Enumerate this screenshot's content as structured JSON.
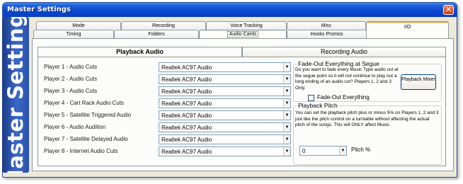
{
  "window": {
    "title": "Master Settings",
    "side_banner": "Master Settings"
  },
  "tabs_top_row": [
    "Mode",
    "Recording",
    "Voice Tracking",
    "Misc",
    "I/O"
  ],
  "tabs_bottom_row": [
    "Timing",
    "Folders",
    "Audio Cards",
    "Hooks Promos"
  ],
  "active_tab": "Audio Cards",
  "subtabs": {
    "playback": "Playback Audio",
    "recording": "Recording Audio"
  },
  "players": [
    {
      "label": "Player 1 - Audio Cuts",
      "value": "Realtek AC97 Audio"
    },
    {
      "label": "Player 2 - Audio Cuts",
      "value": "Realtek AC97 Audio"
    },
    {
      "label": "Player 3 - Audio Cuts",
      "value": "Realtek AC97 Audio"
    },
    {
      "label": "Player 4 - Cart Rack Audio Cuts",
      "value": "Realtek AC97 Audio"
    },
    {
      "label": "Player 5 - Satellite Triggered Audio",
      "value": "Realtek AC97 Audio"
    },
    {
      "label": "Player 6 - Audio Audition",
      "value": "Realtek AC97 Audio"
    },
    {
      "label": "Player 7 - Satellite Delayed Audio",
      "value": "Realtek AC97 Audio"
    },
    {
      "label": "Player 8 - Internet Audio Cuts",
      "value": "Realtek AC97 Audio"
    }
  ],
  "fadeout": {
    "title": "Fade-Out Everything at Segue",
    "description": "Do you want to fade every Music Type audio cut at the segue point so it will not continue to play out a long ending of an audio cut?  Players 1, 2 and 3 Only.",
    "checkbox_label": "Fade-Out Everything",
    "checked": false,
    "mixer_button": "Playback Mixer"
  },
  "pitch": {
    "title": "Playback Pitch",
    "description": "You can set the playback pitch plus or minus 5% on Players 1, 2 and 3 just like the pitch control on a turntable without affecting the actual pitch of the songs.  This will ONLY affect Music.",
    "value": "0",
    "unit_label": "Pitch %"
  },
  "colors": {
    "titlebar": "#0a48d2",
    "side_banner": "#2b52ab",
    "active_tab_highlight": "#e68b2c"
  }
}
